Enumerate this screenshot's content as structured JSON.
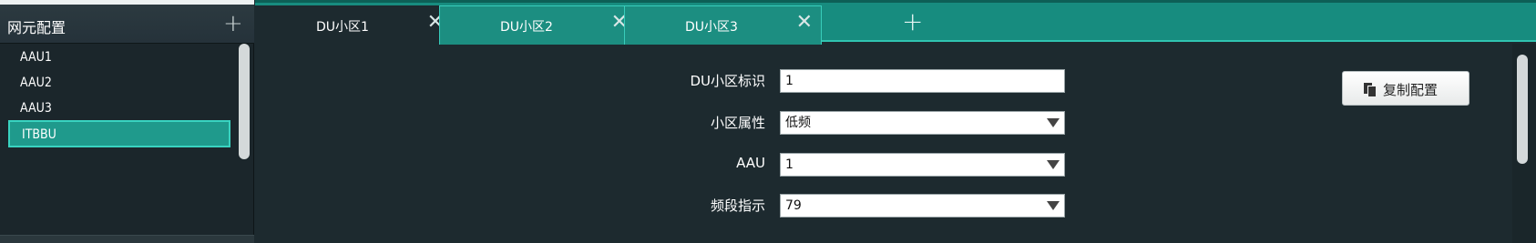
{
  "left_panel": {
    "title": "网元配置",
    "add_symbol": "+",
    "items": [
      {
        "label": "AAU1"
      },
      {
        "label": "AAU2"
      },
      {
        "label": "AAU3"
      },
      {
        "label": "ITBBU",
        "selected": true
      }
    ]
  },
  "tabs": [
    {
      "label": "DU小区1",
      "active": true
    },
    {
      "label": "DU小区2",
      "active": false
    },
    {
      "label": "DU小区3",
      "active": false
    }
  ],
  "tab_close_symbol": "✕",
  "tab_add_symbol": "+",
  "form": {
    "cell_id_label": "DU小区标识",
    "cell_id_value": "1",
    "cell_attr_label": "小区属性",
    "cell_attr_value": "低频",
    "aau_label": "AAU",
    "aau_value": "1",
    "band_label": "频段指示",
    "band_value": "79"
  },
  "copy_button": {
    "label": "复制配置",
    "icon": "copy-icon"
  },
  "colors": {
    "accent": "#178c7f",
    "accent_border": "#38cdbb",
    "background": "#1d2a2f",
    "selected_item": "#1f9a8c"
  }
}
